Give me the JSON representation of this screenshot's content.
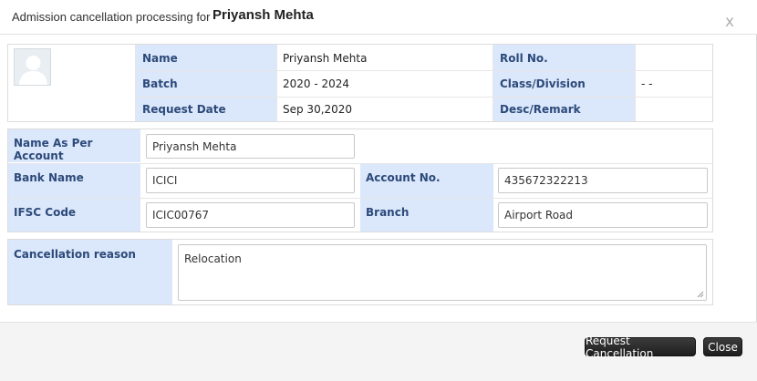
{
  "dialog": {
    "title_prefix": "Admission cancellation processing for",
    "title_name": "Priyansh Mehta",
    "close_glyph": "x"
  },
  "student_info": {
    "avatar_icon": "user-avatar-icon",
    "name_label": "Name",
    "name_value": "Priyansh Mehta",
    "batch_label": "Batch",
    "batch_value": "2020 - 2024",
    "request_date_label": "Request Date",
    "request_date_value": "Sep 30,2020",
    "roll_no_label": "Roll No.",
    "roll_no_value": "",
    "class_division_label": "Class/Division",
    "class_division_value": "- -",
    "desc_remark_label": "Desc/Remark",
    "desc_remark_value": ""
  },
  "bank_form": {
    "name_as_per_account_label": "Name As Per Account",
    "name_as_per_account_value": "Priyansh Mehta",
    "bank_name_label": "Bank Name",
    "bank_name_value": "ICICI",
    "account_no_label": "Account No.",
    "account_no_value": "435672322213",
    "ifsc_code_label": "IFSC Code",
    "ifsc_code_value": "ICIC00767",
    "branch_label": "Branch",
    "branch_value": "Airport Road"
  },
  "cancellation": {
    "reason_label": "Cancellation reason",
    "reason_value": "Relocation"
  },
  "footer": {
    "request_cancellation_label": "Request Cancellation",
    "close_label": "Close"
  },
  "colors": {
    "label_background": "#dbe7fa",
    "label_text": "#2c4a7a",
    "button_background": "#2a2a2a"
  }
}
